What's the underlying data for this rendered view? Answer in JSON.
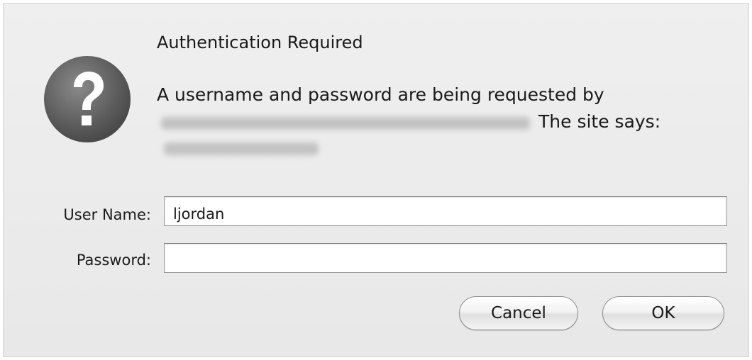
{
  "dialog": {
    "title": "Authentication Required",
    "message_line1": "A username and password are being requested by",
    "message_site_says": "The site says:",
    "icon": "question-mark-icon"
  },
  "form": {
    "username_label": "User Name:",
    "username_value": "ljordan",
    "password_label": "Password:",
    "password_value": ""
  },
  "buttons": {
    "cancel_label": "Cancel",
    "ok_label": "OK"
  },
  "colors": {
    "dialog_background": "#ececec",
    "icon_fill": "#5a5a5a",
    "text": "#1a1a1a"
  }
}
